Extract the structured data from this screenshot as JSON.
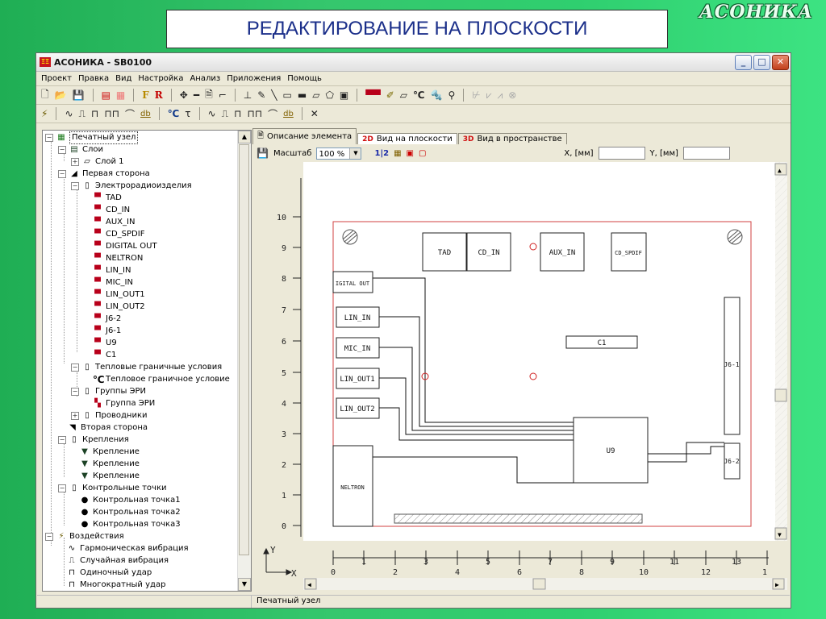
{
  "brand": "АСОНИКА",
  "slide_title": "РЕДАКТИРОВАНИЕ НА ПЛОСКОСТИ",
  "window": {
    "title": "АСОНИКА - SB0100",
    "icon_label": "ΞΞ"
  },
  "menu": [
    "Проект",
    "Правка",
    "Вид",
    "Настройка",
    "Анализ",
    "Приложения",
    "Помощь"
  ],
  "tree": {
    "root": "Печатный узел",
    "layers": "Слои",
    "layer1": "Слой 1",
    "side1": "Первая сторона",
    "eri": "Электрорадиоизделия",
    "components": [
      "TAD",
      "CD_IN",
      "AUX_IN",
      "CD_SPDIF",
      "DIGITAL OUT",
      "NELTRON",
      "LIN_IN",
      "MIC_IN",
      "LIN_OUT1",
      "LIN_OUT2",
      "J6-2",
      "J6-1",
      "U9",
      "C1"
    ],
    "thermal_bc": "Тепловые граничные условия",
    "thermal_bc_item": "Тепловое граничное условие",
    "eri_groups": "Группы ЭРИ",
    "eri_group": "Группа ЭРИ",
    "wires": "Проводники",
    "side2": "Вторая сторона",
    "mounts": "Крепления",
    "mount_items": [
      "Крепление",
      "Крепление",
      "Крепление"
    ],
    "control_points": "Контрольные точки",
    "cp_items": [
      "Контрольная точка1",
      "Контрольная точка2",
      "Контрольная точка3"
    ],
    "actions": "Воздействия",
    "action_items": [
      "Гармоническая вибрация",
      "Случайная вибрация",
      "Одиночный удар",
      "Многократный удар"
    ]
  },
  "tabs": [
    {
      "icon": "",
      "label": "Описание элемента"
    },
    {
      "icon": "2D",
      "label": "Вид на плоскости"
    },
    {
      "icon": "3D",
      "label": "Вид в пространстве"
    }
  ],
  "viewbar": {
    "scale_label": "Масштаб",
    "scale_value": "100 %",
    "x_label": "X, [мм]",
    "y_label": "Y, [мм]",
    "x_value": "",
    "y_value": "",
    "layer_btn": "1|2"
  },
  "board": {
    "y_ticks": [
      "10",
      "9",
      "8",
      "7",
      "6",
      "5",
      "4",
      "3",
      "2",
      "1",
      "0"
    ],
    "x_ticks": [
      "0",
      "1",
      "2",
      "3",
      "4",
      "5",
      "6",
      "7",
      "8",
      "9",
      "10",
      "11",
      "12",
      "13",
      "1"
    ],
    "axis_x": "X",
    "axis_y": "Y",
    "labels": {
      "tad": "TAD",
      "cd_in": "CD_IN",
      "aux_in": "AUX_IN",
      "cd_spdif": "CD_SPDIF",
      "digital_out": "IGITAL OUT",
      "lin_in": "LIN_IN",
      "mic_in": "MIC_IN",
      "lin_out1": "LIN_OUT1",
      "lin_out2": "LIN_OUT2",
      "c1": "C1",
      "u9": "U9",
      "j6_1": "J6-1",
      "j6_2": "J6-2",
      "neltron": "NELTRON"
    }
  },
  "status": {
    "left": "",
    "right": "Печатный узел"
  }
}
